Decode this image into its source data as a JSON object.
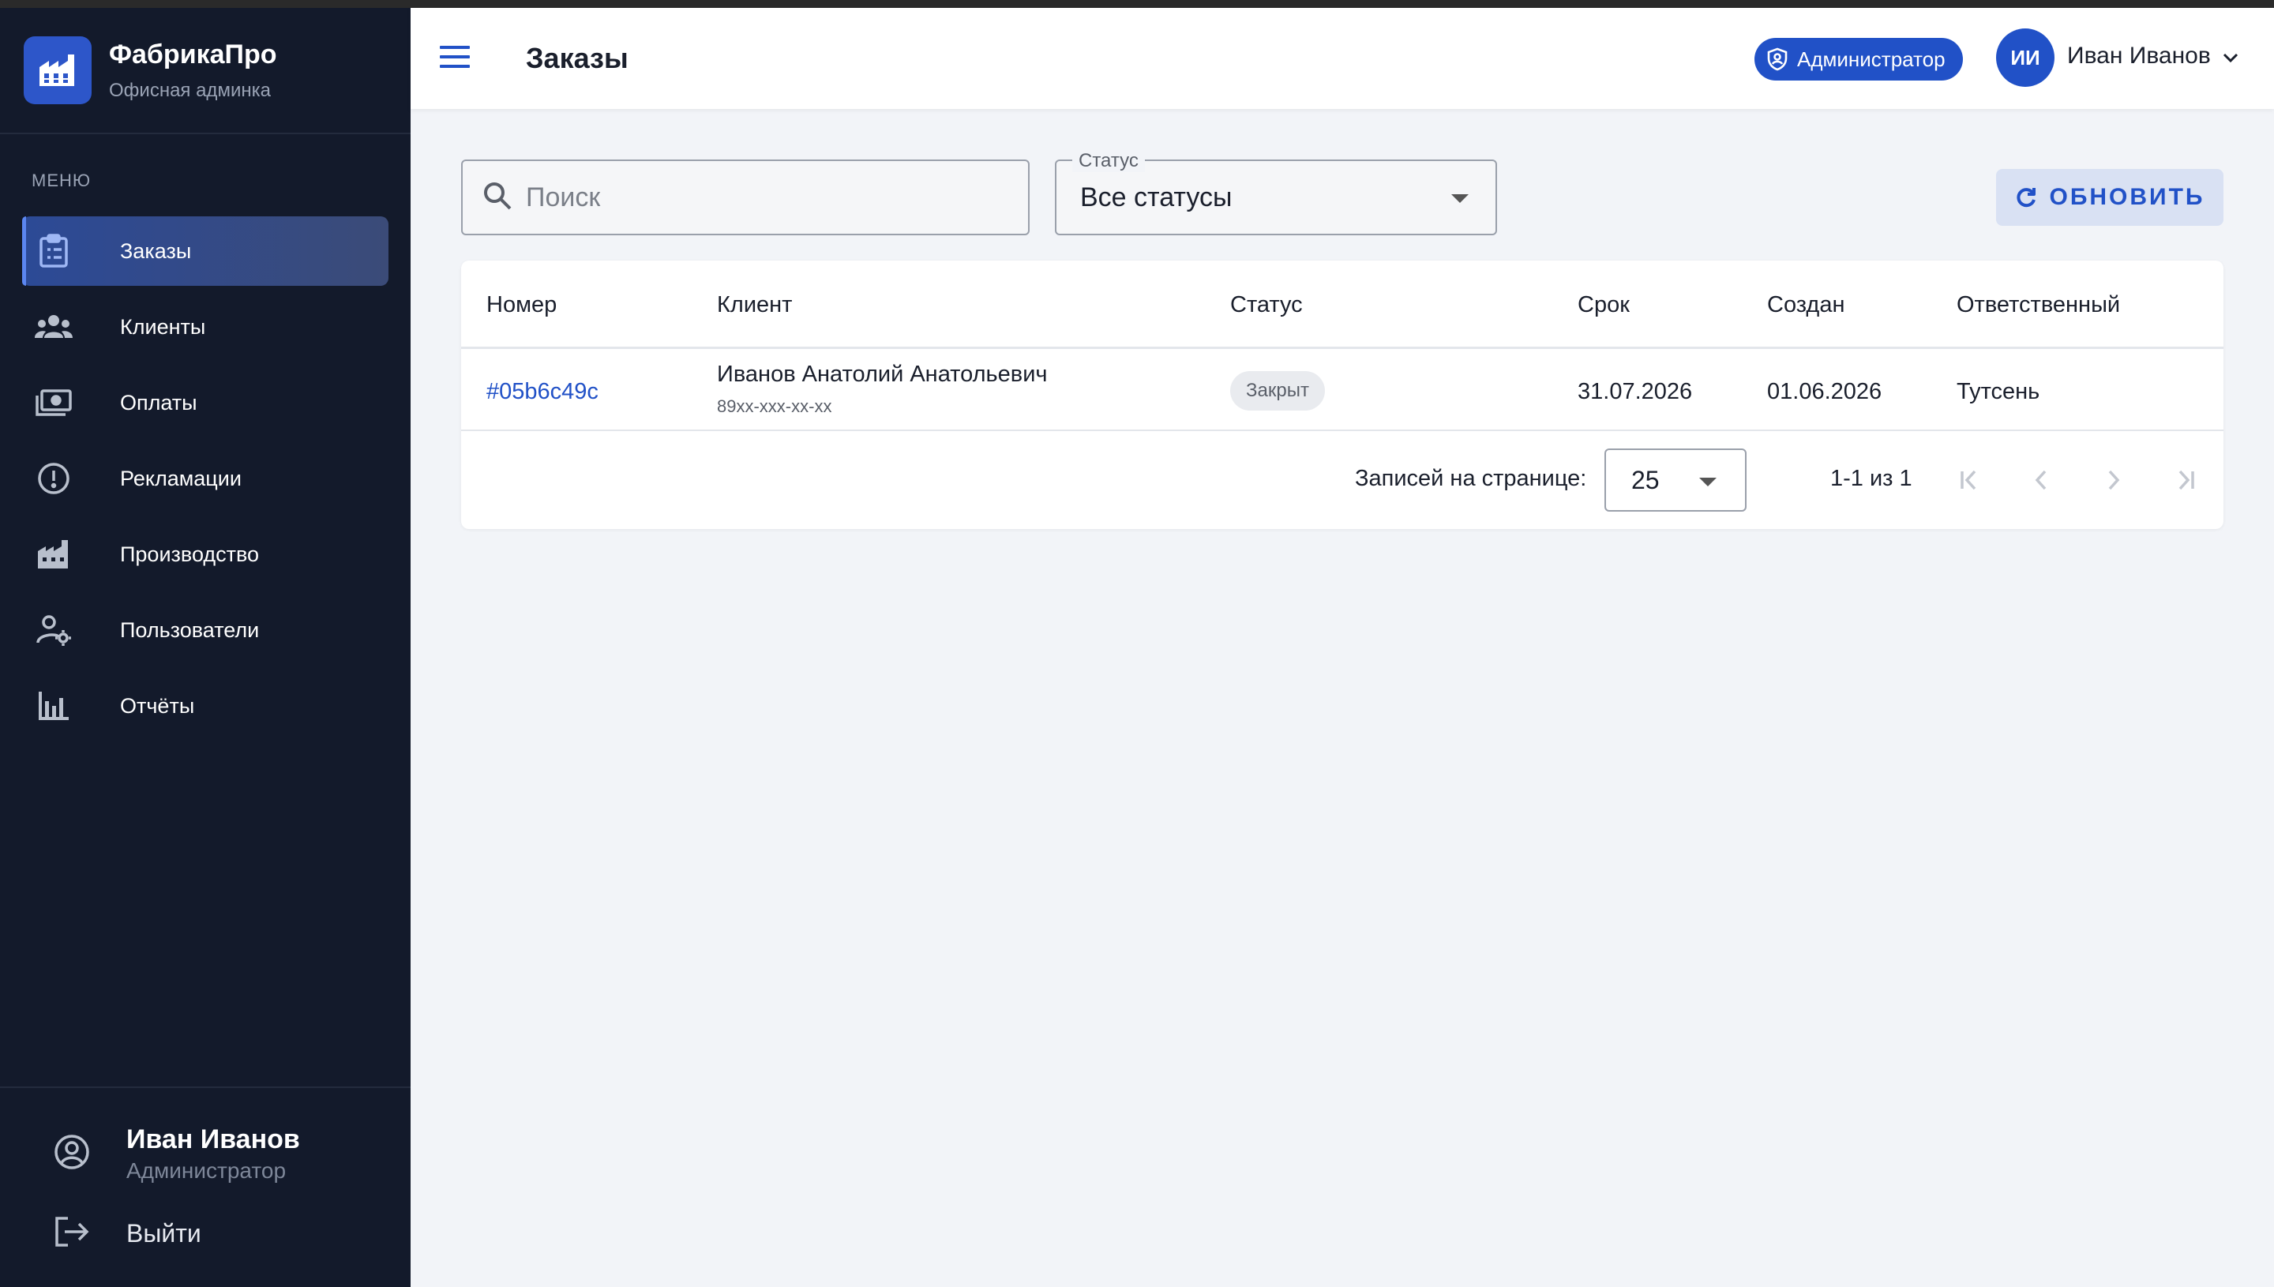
{
  "brand": {
    "name": "ФабрикаПро",
    "subtitle": "Офисная админка",
    "logo_icon": "factory-icon"
  },
  "sidebar": {
    "menu_label": "МЕНЮ",
    "items": [
      {
        "label": "Заказы",
        "icon": "clipboard-list-icon",
        "active": true
      },
      {
        "label": "Клиенты",
        "icon": "people-icon",
        "active": false
      },
      {
        "label": "Оплаты",
        "icon": "payments-icon",
        "active": false
      },
      {
        "label": "Рекламации",
        "icon": "alert-circle-icon",
        "active": false
      },
      {
        "label": "Производство",
        "icon": "factory-icon",
        "active": false
      },
      {
        "label": "Пользователи",
        "icon": "user-settings-icon",
        "active": false
      },
      {
        "label": "Отчёты",
        "icon": "bar-chart-icon",
        "active": false
      }
    ],
    "footer": {
      "user_name": "Иван Иванов",
      "user_role": "Администратор",
      "logout_label": "Выйти"
    }
  },
  "header": {
    "title": "Заказы",
    "role_chip": "Администратор",
    "avatar_initials": "ИИ",
    "user_name": "Иван Иванов"
  },
  "filters": {
    "search_placeholder": "Поиск",
    "search_value": "",
    "status_label": "Статус",
    "status_value": "Все статусы",
    "refresh_label": "ОБНОВИТЬ"
  },
  "table": {
    "columns": [
      "Номер",
      "Клиент",
      "Статус",
      "Срок",
      "Создан",
      "Ответственный"
    ],
    "rows": [
      {
        "number": "#05b6c49c",
        "client_name": "Иванов Анатолий Анатольевич",
        "client_phone": "89xx-xxx-xx-xx",
        "status": "Закрыт",
        "due": "31.07.2026",
        "created": "01.06.2026",
        "assignee": "Тутсень"
      }
    ]
  },
  "pagination": {
    "rows_per_page_label": "Записей на странице:",
    "rows_per_page_value": "25",
    "range": "1-1 из 1"
  },
  "colors": {
    "accent": "#2151c7",
    "sidebar_bg": "#131a2b",
    "page_bg": "#f2f4f8"
  }
}
